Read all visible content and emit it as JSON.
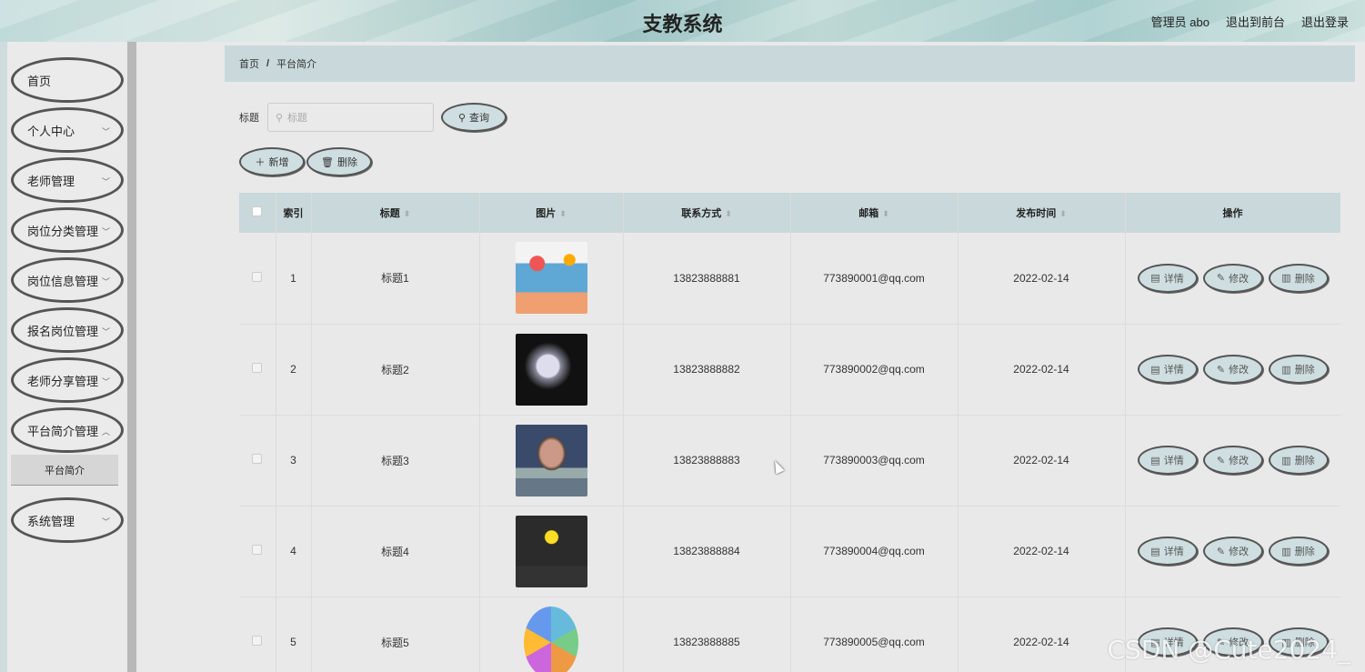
{
  "header": {
    "title": "支教系统",
    "user_label": "管理员 abo",
    "front_link": "退出到前台",
    "logout_link": "退出登录"
  },
  "sidebar": {
    "items": [
      {
        "label": "首页",
        "has_chevron": false
      },
      {
        "label": "个人中心",
        "has_chevron": true
      },
      {
        "label": "老师管理",
        "has_chevron": true
      },
      {
        "label": "岗位分类管理",
        "has_chevron": true
      },
      {
        "label": "岗位信息管理",
        "has_chevron": true
      },
      {
        "label": "报名岗位管理",
        "has_chevron": true
      },
      {
        "label": "老师分享管理",
        "has_chevron": true
      },
      {
        "label": "平台简介管理",
        "has_chevron": true
      },
      {
        "label": "系统管理",
        "has_chevron": true
      }
    ],
    "submenu_active": "平台简介"
  },
  "breadcrumb": {
    "home": "首页",
    "separator": "/",
    "current": "平台简介"
  },
  "search": {
    "label": "标题",
    "placeholder": "标题",
    "query_button": "查询"
  },
  "actions": {
    "add": "新增",
    "delete": "删除"
  },
  "table": {
    "headers": {
      "index": "索引",
      "title": "标题",
      "image": "图片",
      "contact": "联系方式",
      "email": "邮箱",
      "publish_time": "发布时间",
      "operations": "操作"
    },
    "rows": [
      {
        "index": "1",
        "title": "标题1",
        "contact": "13823888881",
        "email": "773890001@qq.com",
        "date": "2022-02-14"
      },
      {
        "index": "2",
        "title": "标题2",
        "contact": "13823888882",
        "email": "773890002@qq.com",
        "date": "2022-02-14"
      },
      {
        "index": "3",
        "title": "标题3",
        "contact": "13823888883",
        "email": "773890003@qq.com",
        "date": "2022-02-14"
      },
      {
        "index": "4",
        "title": "标题4",
        "contact": "13823888884",
        "email": "773890004@qq.com",
        "date": "2022-02-14"
      },
      {
        "index": "5",
        "title": "标题5",
        "contact": "13823888885",
        "email": "773890005@qq.com",
        "date": "2022-02-14"
      }
    ],
    "op_labels": {
      "detail": "详情",
      "edit": "修改",
      "delete": "删除"
    }
  },
  "watermark": "CSDN @Cute2024_",
  "colors": {
    "header_bg": "#a7cdcd",
    "panel": "#c9d8db",
    "page_bg": "#e9e9e9"
  }
}
